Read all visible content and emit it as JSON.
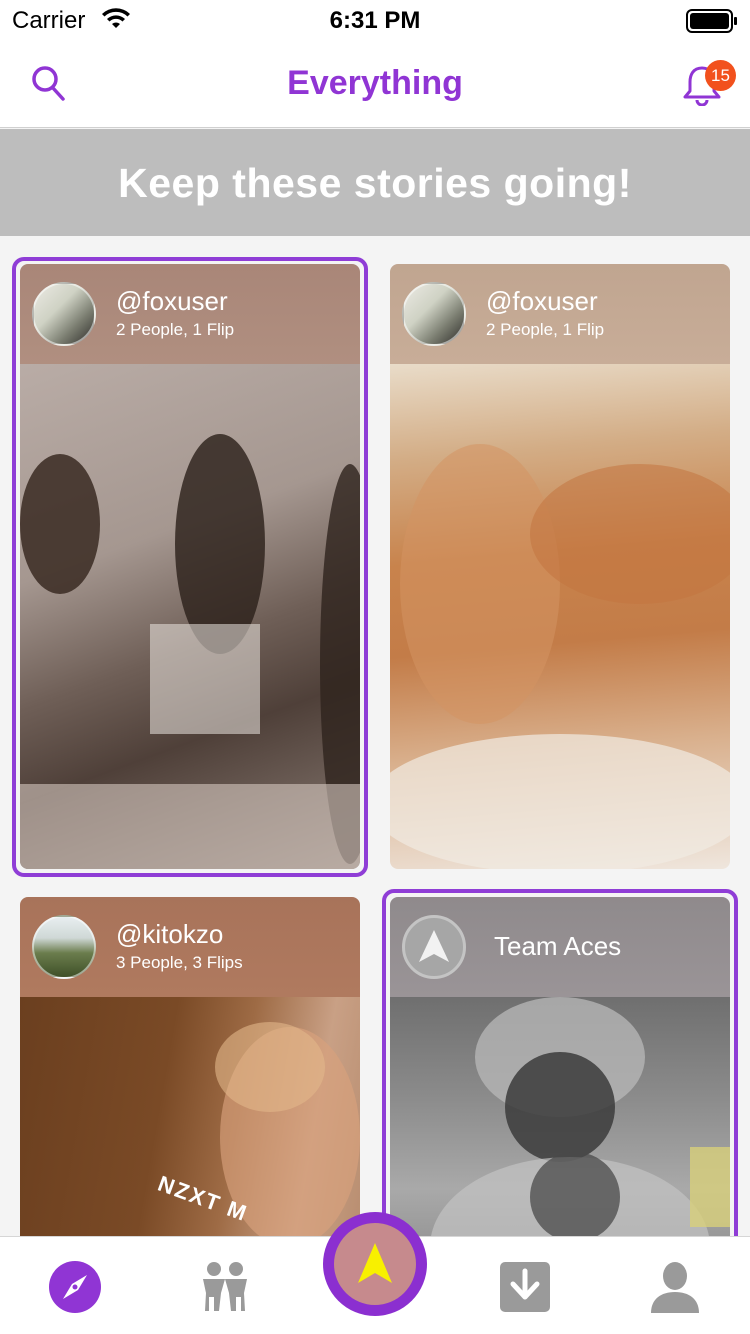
{
  "status_bar": {
    "carrier": "Carrier",
    "time": "6:31 PM"
  },
  "nav": {
    "title": "Everything",
    "notification_count": "15"
  },
  "banner": {
    "text": "Keep these stories going!"
  },
  "cards": [
    {
      "username": "@foxuser",
      "meta": "2 People, 1 Flip",
      "selected": true
    },
    {
      "username": "@foxuser",
      "meta": "2 People, 1 Flip",
      "selected": false
    },
    {
      "username": "@kitokzo",
      "meta": "3 People, 3 Flips",
      "selected": false
    },
    {
      "team_name": "Team Aces",
      "selected": true
    }
  ],
  "sticker_text": "NZXT M",
  "tabs": [
    "explore-tab",
    "friends-tab",
    "create-flip-button",
    "downloads-tab",
    "profile-tab"
  ],
  "colors": {
    "accent": "#9035d4",
    "badge": "#f2511d",
    "banner": "#bdbdbd",
    "tab_icon": "#9a9a9a"
  }
}
